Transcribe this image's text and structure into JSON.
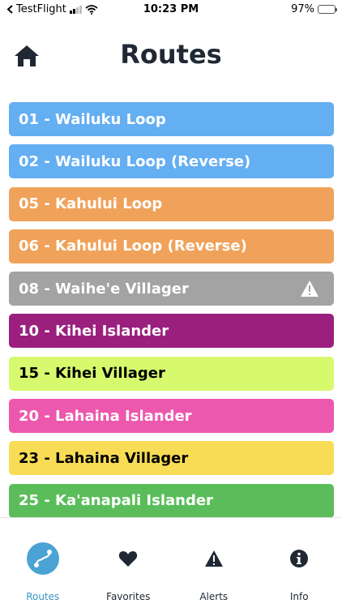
{
  "status_bar": {
    "carrier": "TestFlight",
    "time": "10:23 PM",
    "battery": "97%",
    "battery_level": 0.97
  },
  "header": {
    "title": "Routes",
    "home_icon": "home-icon"
  },
  "routes": [
    {
      "label": "01 - Wailuku Loop",
      "color": "#64aef2",
      "text_color": "#ffffff",
      "alert": false
    },
    {
      "label": "02 - Wailuku Loop (Reverse)",
      "color": "#64aef2",
      "text_color": "#ffffff",
      "alert": false
    },
    {
      "label": "05 - Kahului Loop",
      "color": "#f0a25a",
      "text_color": "#ffffff",
      "alert": false
    },
    {
      "label": "06 - Kahului Loop (Reverse)",
      "color": "#f0a25a",
      "text_color": "#ffffff",
      "alert": false
    },
    {
      "label": "08 - Waihe'e Villager",
      "color": "#a3a3a3",
      "text_color": "#ffffff",
      "alert": true
    },
    {
      "label": "10 - Kihei Islander",
      "color": "#9b1f7d",
      "text_color": "#ffffff",
      "alert": false
    },
    {
      "label": "15 - Kihei Villager",
      "color": "#d7f96d",
      "text_color": "#000000",
      "alert": false
    },
    {
      "label": "20 - Lahaina Islander",
      "color": "#ec58ad",
      "text_color": "#ffffff",
      "alert": false
    },
    {
      "label": "23 - Lahaina Villager",
      "color": "#f8dc55",
      "text_color": "#000000",
      "alert": false
    },
    {
      "label": "25 - Ka'anapali Islander",
      "color": "#5bbd5a",
      "text_color": "#ffffff",
      "alert": false
    }
  ],
  "tabs": [
    {
      "label": "Routes",
      "icon": "route-icon",
      "active": true
    },
    {
      "label": "Favorites",
      "icon": "heart-icon",
      "active": false
    },
    {
      "label": "Alerts",
      "icon": "alert-icon",
      "active": false
    },
    {
      "label": "Info",
      "icon": "info-icon",
      "active": false
    }
  ],
  "colors": {
    "accent": "#4aa3d4",
    "title": "#1f2833"
  }
}
